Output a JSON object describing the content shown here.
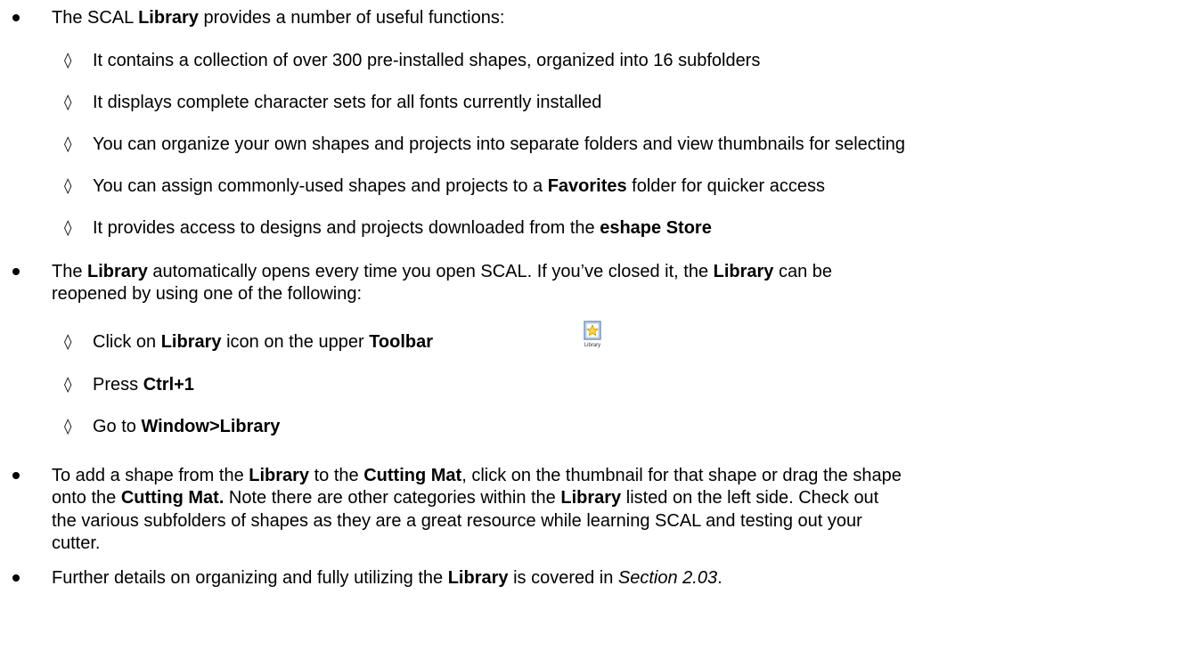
{
  "diamond": "◊",
  "b1": {
    "pre": "The SCAL ",
    "bold": "Library",
    "post": " provides a number of useful functions:",
    "subs": [
      "It contains a collection of over 300 pre-installed shapes, organized into 16 subfolders",
      "It displays complete character sets for all fonts currently installed",
      "You can organize your own shapes and projects into separate folders and view thumbnails for selecting"
    ],
    "sub4": {
      "pre": "You can assign commonly-used shapes and projects to a ",
      "bold": "Favorites",
      "post": " folder for quicker access"
    },
    "sub5": {
      "pre": "It provides access to designs and projects downloaded from the ",
      "bold": "eshape Store"
    }
  },
  "b2": {
    "l1_a": "The ",
    "l1_b": "Library",
    "l1_c": " automatically opens every time you open SCAL.  If you’ve closed it, the ",
    "l1_d": "Library",
    "l1_e": " can be",
    "l2": "reopened by using one of the following:",
    "sub1": {
      "a": "Click on ",
      "b": "Library",
      "c": " icon on the upper ",
      "d": "Toolbar"
    },
    "icon_label": "Library",
    "sub2": {
      "a": "Press ",
      "b": "Ctrl+1"
    },
    "sub3": {
      "a": "Go to ",
      "b": "Window>Library"
    }
  },
  "b3": {
    "l1_a": "To add a shape from the ",
    "l1_b": "Library",
    "l1_c": " to the ",
    "l1_d": "Cutting Mat",
    "l1_e": ", click on the thumbnail for that shape or drag the shape",
    "l2_a": "onto the ",
    "l2_b": "Cutting Mat.",
    "l2_c": " Note there are other categories within the ",
    "l2_d": "Library",
    "l2_e": " listed on the left side. Check out",
    "l3": "the various subfolders of shapes as they are a great resource while learning SCAL and testing out your",
    "l4": "cutter."
  },
  "b4": {
    "a": "Further details on organizing and fully utilizing the ",
    "b": "Library",
    "c": " is covered in ",
    "d": "Section 2.03",
    "e": "."
  }
}
